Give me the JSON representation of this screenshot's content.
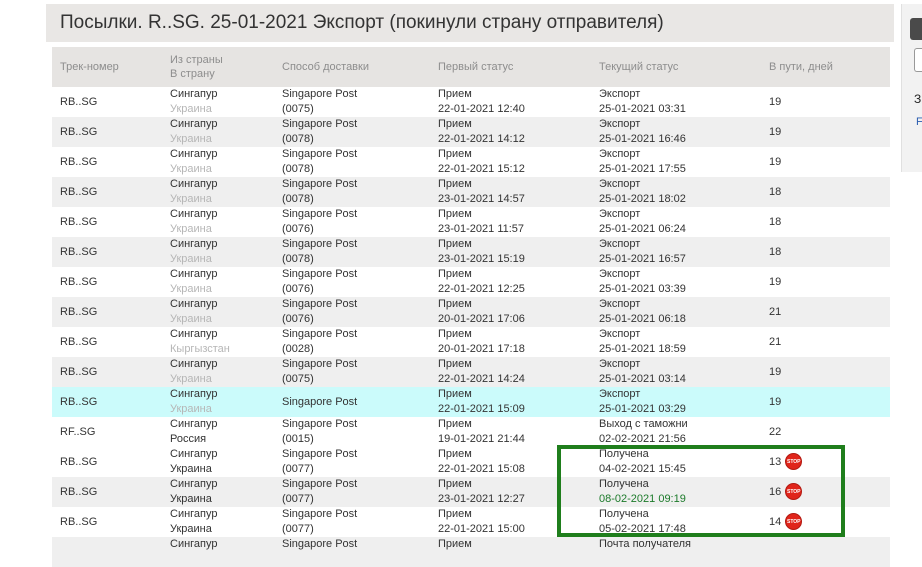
{
  "title": "Посылки. R..SG. 25-01-2021 Экспорт (покинули страну отправителя)",
  "headers": {
    "track": "Трек-номер",
    "from": "Из страны",
    "to": "В страну",
    "delivery": "Способ доставки",
    "first": "Первый статус",
    "current": "Текущий статус",
    "days": "В пути, дней"
  },
  "stop_label": "STOP",
  "right_panel": {
    "t1": "З",
    "t2": "F"
  },
  "rows": [
    {
      "track": "RB..SG",
      "from": "Сингапур",
      "to": "Украина",
      "del1": "Singapore Post",
      "del2": "(0075)",
      "f1": "Прием",
      "f2": "22-01-2021 12:40",
      "c1": "Экспорт",
      "c2": "25-01-2021 03:31",
      "days": "19"
    },
    {
      "track": "RB..SG",
      "from": "Сингапур",
      "to": "Украина",
      "del1": "Singapore Post",
      "del2": "(0078)",
      "f1": "Прием",
      "f2": "22-01-2021 14:12",
      "c1": "Экспорт",
      "c2": "25-01-2021 16:46",
      "days": "19"
    },
    {
      "track": "RB..SG",
      "from": "Сингапур",
      "to": "Украина",
      "del1": "Singapore Post",
      "del2": "(0078)",
      "f1": "Прием",
      "f2": "22-01-2021 15:12",
      "c1": "Экспорт",
      "c2": "25-01-2021 17:55",
      "days": "19"
    },
    {
      "track": "RB..SG",
      "from": "Сингапур",
      "to": "Украина",
      "del1": "Singapore Post",
      "del2": "(0078)",
      "f1": "Прием",
      "f2": "23-01-2021 14:57",
      "c1": "Экспорт",
      "c2": "25-01-2021 18:02",
      "days": "18"
    },
    {
      "track": "RB..SG",
      "from": "Сингапур",
      "to": "Украина",
      "del1": "Singapore Post",
      "del2": "(0076)",
      "f1": "Прием",
      "f2": "23-01-2021 11:57",
      "c1": "Экспорт",
      "c2": "25-01-2021 06:24",
      "days": "18"
    },
    {
      "track": "RB..SG",
      "from": "Сингапур",
      "to": "Украина",
      "del1": "Singapore Post",
      "del2": "(0078)",
      "f1": "Прием",
      "f2": "23-01-2021 15:19",
      "c1": "Экспорт",
      "c2": "25-01-2021 16:57",
      "days": "18"
    },
    {
      "track": "RB..SG",
      "from": "Сингапур",
      "to": "Украина",
      "del1": "Singapore Post",
      "del2": "(0076)",
      "f1": "Прием",
      "f2": "22-01-2021 12:25",
      "c1": "Экспорт",
      "c2": "25-01-2021 03:39",
      "days": "19"
    },
    {
      "track": "RB..SG",
      "from": "Сингапур",
      "to": "Украина",
      "del1": "Singapore Post",
      "del2": "(0076)",
      "f1": "Прием",
      "f2": "20-01-2021 17:06",
      "c1": "Экспорт",
      "c2": "25-01-2021 06:18",
      "days": "21"
    },
    {
      "track": "RB..SG",
      "from": "Сингапур",
      "to": "Кыргызстан",
      "del1": "Singapore Post",
      "del2": "(0028)",
      "f1": "Прием",
      "f2": "20-01-2021 17:18",
      "c1": "Экспорт",
      "c2": "25-01-2021 18:59",
      "days": "21"
    },
    {
      "track": "RB..SG",
      "from": "Сингапур",
      "to": "Украина",
      "del1": "Singapore Post",
      "del2": "(0075)",
      "f1": "Прием",
      "f2": "22-01-2021 14:24",
      "c1": "Экспорт",
      "c2": "25-01-2021 03:14",
      "days": "19"
    },
    {
      "track": "RB..SG",
      "from": "Сингапур",
      "to": "Украина",
      "del1": "Singapore Post",
      "del2": "",
      "f1": "Прием",
      "f2": "22-01-2021 15:09",
      "c1": "Экспорт",
      "c2": "25-01-2021 03:29",
      "days": "19"
    },
    {
      "track": "RF..SG",
      "from": "Сингапур",
      "to": "Россия",
      "del1": "Singapore Post",
      "del2": "(0015)",
      "f1": "Прием",
      "f2": "19-01-2021 21:44",
      "c1": "Выход с таможни",
      "c2": "02-02-2021 21:56",
      "days": "22"
    },
    {
      "track": "RB..SG",
      "from": "Сингапур",
      "to": "Украина",
      "del1": "Singapore Post",
      "del2": "(0077)",
      "f1": "Прием",
      "f2": "22-01-2021 15:08",
      "c1": "Получена",
      "c2": "04-02-2021 15:45",
      "days": "13"
    },
    {
      "track": "RB..SG",
      "from": "Сингапур",
      "to": "Украина",
      "del1": "Singapore Post",
      "del2": "(0077)",
      "f1": "Прием",
      "f2": "23-01-2021 12:27",
      "c1": "Получена",
      "c2": "08-02-2021 09:19",
      "days": "16"
    },
    {
      "track": "RB..SG",
      "from": "Сингапур",
      "to": "Украина",
      "del1": "Singapore Post",
      "del2": "(0077)",
      "f1": "Прием",
      "f2": "22-01-2021 15:00",
      "c1": "Получена",
      "c2": "05-02-2021 17:48",
      "days": "14"
    },
    {
      "track": "",
      "from": "Сингапур",
      "to": "",
      "del1": "Singapore Post",
      "del2": "",
      "f1": "Прием",
      "f2": "",
      "c1": "Почта получателя",
      "c2": "",
      "days": ""
    }
  ]
}
